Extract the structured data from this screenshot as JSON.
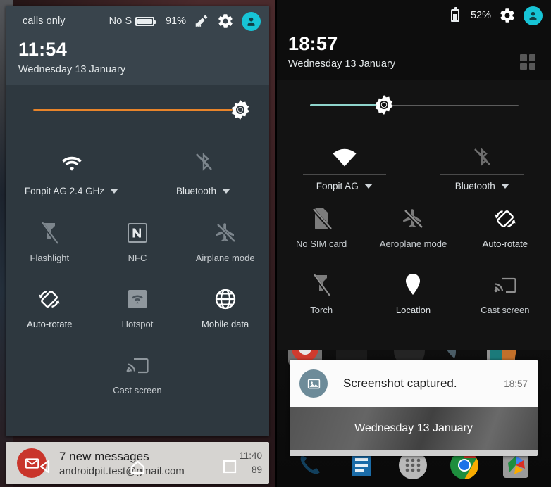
{
  "left_panel": {
    "status_bar": {
      "carrier_text": "calls only",
      "sim_text": "No S",
      "battery_percent": "91%",
      "battery_level": 91,
      "icons": [
        "battery-icon",
        "edit-icon",
        "settings-gear-icon",
        "user-avatar-icon"
      ]
    },
    "clock": "11:54",
    "date": "Wednesday 13 January",
    "brightness": {
      "color": "#e8842a",
      "value": 93,
      "thumb_icon": "brightness-sun-icon"
    },
    "connectivity": [
      {
        "name": "wifi",
        "icon": "wifi-icon",
        "label": "Fonpit AG 2.4 GHz",
        "active": true,
        "has_caret": true
      },
      {
        "name": "bluetooth",
        "icon": "bluetooth-off-icon",
        "label": "Bluetooth",
        "active": false,
        "has_caret": true
      }
    ],
    "tiles": [
      {
        "name": "flashlight",
        "icon": "flashlight-off-icon",
        "label": "Flashlight",
        "active": false
      },
      {
        "name": "nfc",
        "icon": "nfc-icon",
        "label": "NFC",
        "active": false
      },
      {
        "name": "airplane-mode",
        "icon": "airplane-off-icon",
        "label": "Airplane mode",
        "active": false
      },
      {
        "name": "auto-rotate",
        "icon": "auto-rotate-icon",
        "label": "Auto-rotate",
        "active": true
      },
      {
        "name": "hotspot",
        "icon": "hotspot-icon",
        "label": "Hotspot",
        "active": false
      },
      {
        "name": "mobile-data",
        "icon": "globe-icon",
        "label": "Mobile data",
        "active": true
      },
      {
        "name": "cast-screen",
        "icon": "cast-screen-icon",
        "label": "Cast screen",
        "active": false
      }
    ],
    "notification": {
      "app_icon": "gmail-icon",
      "title": "7 new messages",
      "subtitle": "androidpit.test@gmail.com",
      "time": "11:40",
      "count": "89"
    },
    "nav_bar": [
      "back-icon",
      "home-icon",
      "recents-icon"
    ],
    "colors": {
      "panel": "#2e383f",
      "header": "#39444c",
      "accent": "#e8842a",
      "avatar": "#17c4d6"
    }
  },
  "right_panel": {
    "status_bar": {
      "battery_percent": "52%",
      "battery_level": 52,
      "icons": [
        "battery-icon",
        "settings-gear-icon",
        "user-avatar-icon"
      ]
    },
    "clock": "18:57",
    "date": "Wednesday 13 January",
    "grid_toggle_icon": "grid-view-icon",
    "brightness": {
      "color": "#8fd4cc",
      "value": 33,
      "thumb_icon": "brightness-sun-icon"
    },
    "connectivity": [
      {
        "name": "wifi",
        "icon": "wifi-icon",
        "label": "Fonpit AG",
        "active": true,
        "has_caret": true
      },
      {
        "name": "bluetooth",
        "icon": "bluetooth-off-icon",
        "label": "Bluetooth",
        "active": false,
        "has_caret": true
      }
    ],
    "tiles": [
      {
        "name": "no-sim-card",
        "icon": "no-sim-card-icon",
        "label": "No SIM card",
        "active": false
      },
      {
        "name": "aeroplane-mode",
        "icon": "airplane-off-icon",
        "label": "Aeroplane mode",
        "active": false
      },
      {
        "name": "auto-rotate",
        "icon": "auto-rotate-icon",
        "label": "Auto-rotate",
        "active": true
      },
      {
        "name": "torch",
        "icon": "flashlight-off-icon",
        "label": "Torch",
        "active": false
      },
      {
        "name": "location",
        "icon": "location-pin-icon",
        "label": "Location",
        "active": true
      },
      {
        "name": "cast-screen",
        "icon": "cast-screen-icon",
        "label": "Cast screen",
        "active": false
      }
    ],
    "notification": {
      "app_icon": "image-icon",
      "title": "Screenshot captured.",
      "time": "18:57",
      "band_text": "Wednesday 13 January"
    },
    "dock": [
      "phone-icon",
      "docs-icon",
      "app-drawer-icon",
      "chrome-icon",
      "photos-icon"
    ],
    "colors": {
      "panel": "#131313",
      "header": "#0d0d0d",
      "accent": "#8fd4cc",
      "avatar": "#17c4d6"
    }
  }
}
